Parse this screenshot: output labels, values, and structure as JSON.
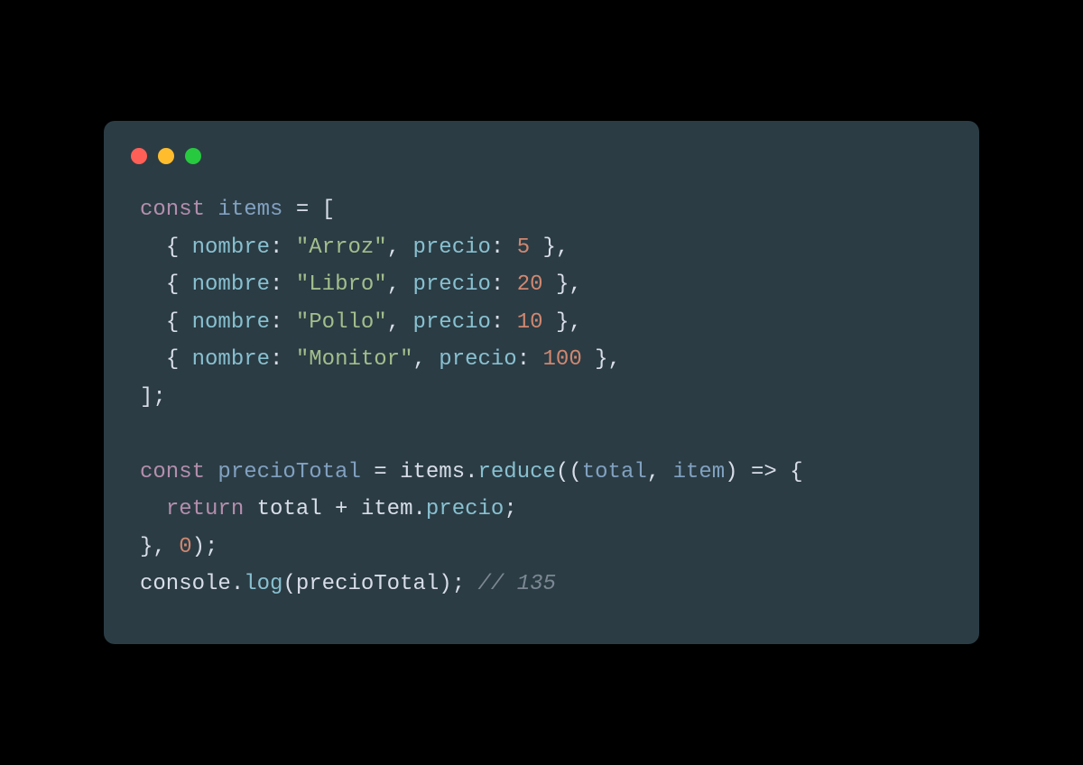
{
  "code": {
    "const1": "const",
    "varItems": "items",
    "eq": " = ",
    "openBracket": "[",
    "openBrace": "{ ",
    "closeBraceComma": " },",
    "propNombre": "nombre",
    "propPrecio": "precio",
    "colon": ": ",
    "comma": ", ",
    "item1Name": "\"Arroz\"",
    "item1Price": "5",
    "item2Name": "\"Libro\"",
    "item2Price": "20",
    "item3Name": "\"Pollo\"",
    "item3Price": "10",
    "item4Name": "\"Monitor\"",
    "item4Price": "100",
    "closeBracketSemi": "];",
    "varPrecioTotal": "precioTotal",
    "itemsObj": "items",
    "dot": ".",
    "reduceFn": "reduce",
    "openParen": "(",
    "openParen2": "((",
    "paramTotal": "total",
    "paramItem": "item",
    "closeParen": ")",
    "arrow": " => ",
    "openBraceOnly": "{",
    "return": "return",
    "total": "total",
    "plus": " + ",
    "item": "item",
    "precio": "precio",
    "semi": ";",
    "closeBraceOnly": "}",
    "zero": "0",
    "closeParenSemi": ");",
    "console": "console",
    "logFn": "log",
    "comment": "// 135",
    "indent": "  "
  }
}
